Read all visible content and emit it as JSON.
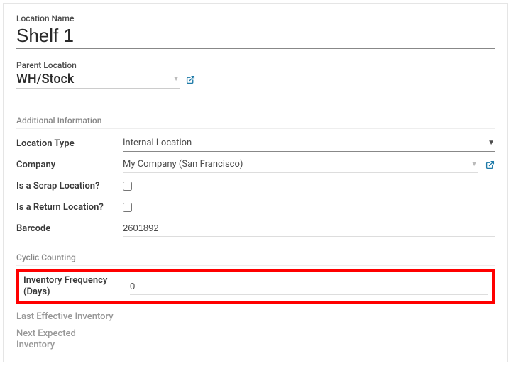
{
  "header": {
    "nameLabel": "Location Name",
    "nameValue": "Shelf 1",
    "parentLabel": "Parent Location",
    "parentValue": "WH/Stock"
  },
  "sections": {
    "additional": {
      "title": "Additional Information",
      "locationType": {
        "label": "Location Type",
        "value": "Internal Location"
      },
      "company": {
        "label": "Company",
        "value": "My Company (San Francisco)"
      },
      "isScrap": {
        "label": "Is a Scrap Location?",
        "checked": false
      },
      "isReturn": {
        "label": "Is a Return Location?",
        "checked": false
      },
      "barcode": {
        "label": "Barcode",
        "value": "2601892"
      }
    },
    "cyclic": {
      "title": "Cyclic Counting",
      "inventoryFreq": {
        "label": "Inventory Frequency (Days)",
        "value": "0"
      },
      "lastEffective": {
        "label": "Last Effective Inventory",
        "value": ""
      },
      "nextExpected": {
        "label": "Next Expected Inventory",
        "value": ""
      }
    }
  }
}
